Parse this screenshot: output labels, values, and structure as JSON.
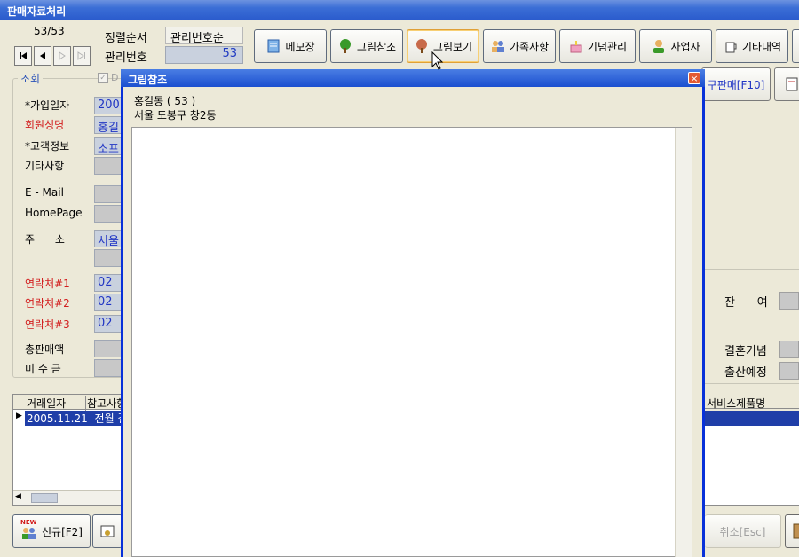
{
  "window": {
    "title": "판매자료처리"
  },
  "nav": {
    "counter": "53/53"
  },
  "sort": {
    "label": "정렬순서",
    "value": "관리번호순"
  },
  "mgmt": {
    "label": "관리번호",
    "value": "53"
  },
  "toolbar": [
    {
      "id": "memo",
      "label": "메모장",
      "icon": "notepad-icon"
    },
    {
      "id": "pic-ref",
      "label": "그림참조",
      "icon": "tree-icon"
    },
    {
      "id": "pic-view",
      "label": "그림보기",
      "icon": "tree-icon"
    },
    {
      "id": "family",
      "label": "가족사항",
      "icon": "people-icon"
    },
    {
      "id": "anniv",
      "label": "기념관리",
      "icon": "cake-icon"
    },
    {
      "id": "business",
      "label": "사업자",
      "icon": "person-icon"
    },
    {
      "id": "etc",
      "label": "기타내역",
      "icon": "cup-icon"
    }
  ],
  "second_row": {
    "f10_label": "구판매[F10]"
  },
  "group": {
    "title": "조회",
    "checkbox_label": "D",
    "fields": [
      {
        "label": "*가입일자",
        "value": "200",
        "red": false
      },
      {
        "label": "회원성명",
        "value": "홍길",
        "red": true
      },
      {
        "label": "*고객정보",
        "value": "소프",
        "red": false
      },
      {
        "label": "기타사항",
        "value": "",
        "red": false
      },
      {
        "label": "E - Mail",
        "value": "",
        "red": false
      },
      {
        "label": "HomePage",
        "value": "",
        "red": false
      },
      {
        "label": "주      소",
        "value": "서울",
        "red": false
      },
      {
        "label": "연락처#1",
        "value": "02",
        "red": true
      },
      {
        "label": "연락처#2",
        "value": "02",
        "red": true
      },
      {
        "label": "연락처#3",
        "value": "02",
        "red": true
      },
      {
        "label": "총판매액",
        "value": "",
        "red": false
      },
      {
        "label": "미 수 금",
        "value": "",
        "red": false
      }
    ]
  },
  "grid": {
    "headers": [
      "거래일자",
      "참고사항"
    ],
    "rows": [
      {
        "date": "2005.11.21",
        "note": "전월 결"
      }
    ],
    "right_header": "서비스제품명"
  },
  "right": {
    "balance_label": "잔      여",
    "wedding_label": "결혼기념",
    "birth_label": "출산예정"
  },
  "bottom": {
    "new_label": "신규[F2]",
    "new_badge": "NEW",
    "cancel_label": "취소[Esc]"
  },
  "dialog": {
    "title": "그림참조",
    "line1": "홍길동 ( 53 )",
    "line2": "서울 도봉구 창2동",
    "close": "×"
  }
}
